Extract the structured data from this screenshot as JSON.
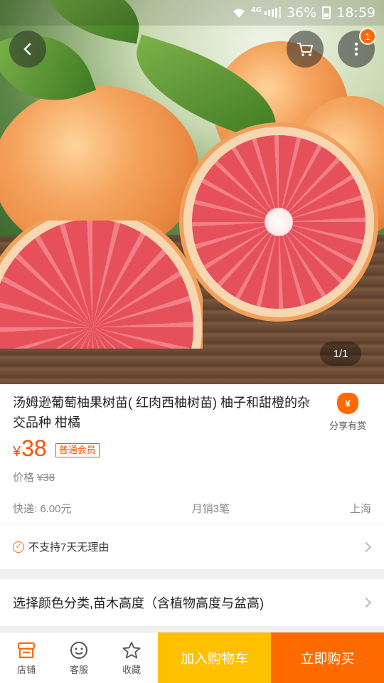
{
  "status_bar": {
    "network": "4G",
    "battery": "36%",
    "time": "18:59"
  },
  "gallery": {
    "pager": "1/1",
    "cart_badge": "1"
  },
  "product": {
    "title": "汤姆逊葡萄柚果树苗( 红肉西柚树苗) 柚子和甜橙的杂交品种 柑橘",
    "currency": "¥",
    "price": "38",
    "member_tag": "普通会员",
    "orig_label": "价格",
    "orig_price": "¥38",
    "shipping": "快递: 6.00元",
    "monthly_sales": "月销3笔",
    "location": "上海"
  },
  "share": {
    "label": "分享有赏",
    "icon_glyph": "¥"
  },
  "service": {
    "text": "不支持7天无理由"
  },
  "sku": {
    "text": "选择颜色分类,苗木高度（含植物高度与盆高)"
  },
  "bottom_bar": {
    "store": "店铺",
    "service": "客服",
    "favorite": "收藏",
    "add_cart": "加入购物车",
    "buy_now": "立即购买"
  },
  "colors": {
    "accent": "#ff5000",
    "cart_button": "#ffc000",
    "buy_button": "#ff6a00"
  }
}
